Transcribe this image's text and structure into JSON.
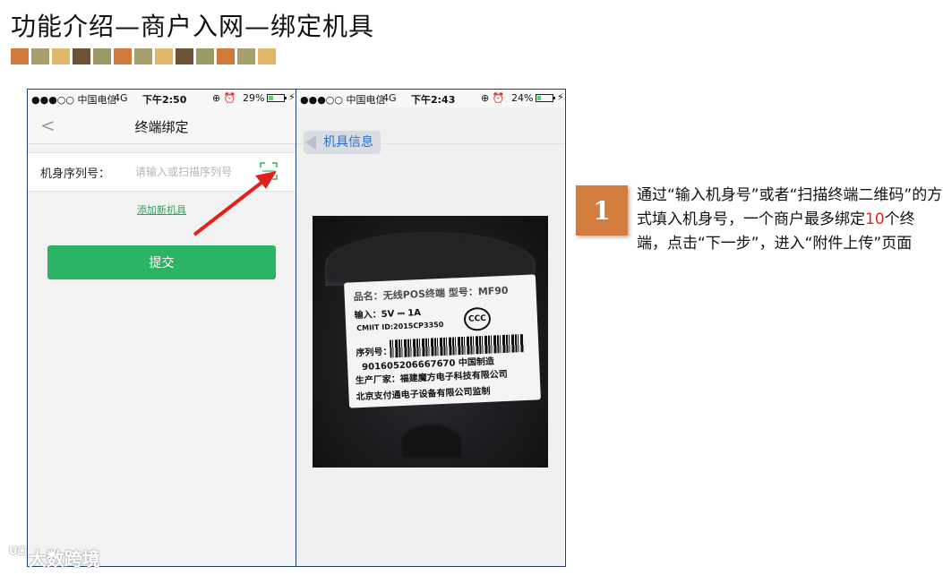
{
  "slide": {
    "title": "功能介绍—商户入网—绑定机具",
    "swatch_colors": [
      "#d07a3c",
      "#a79f6c",
      "#e2b769",
      "#6e5235",
      "#9b9a66",
      "#d07a3c",
      "#a79f6c",
      "#e2b769",
      "#6e5235",
      "#9b9a66",
      "#d07a3c",
      "#a79f6c",
      "#e2b769"
    ]
  },
  "phone_left": {
    "status": {
      "carrier": "●●●○○ 中国电信",
      "network": "4G",
      "time": "下午2:50",
      "icons": "⊕ ⏰",
      "battery_text": "29%",
      "battery_level": 0.29
    },
    "nav": {
      "back_icon": "chevron-left-icon",
      "title": "终端绑定"
    },
    "form": {
      "label": "机身序列号：",
      "placeholder": "请输入或扫描序列号",
      "value": ""
    },
    "add_link": "添加新机具",
    "submit": "提交"
  },
  "phone_right": {
    "status": {
      "carrier": "●●●○○ 中国电信",
      "network": "4G",
      "time": "下午2:43",
      "icons": "⊕ ⏰",
      "battery_text": "24%",
      "battery_level": 0.24
    },
    "nav": {
      "back_label": "机具信息"
    },
    "device_label": {
      "line1": "品名：无线POS终端 型号：MF90",
      "line2": "输入：5V ⎓ 1A",
      "line3": "CMIIT ID:2015CP3350",
      "line4": "序列号：",
      "serial": "901605206667670 中国制造",
      "line6": "生产厂家：福建魔方电子科技有限公司",
      "line7": "北京支付通电子设备有限公司监制",
      "cert": "CCC"
    }
  },
  "step": {
    "number": "1",
    "text_before": "通过“输入机身号”或者“扫描终端二维码”的方式填入机身号，一个商户最多绑定",
    "highlight": "10",
    "text_after": "个终端，点击“下一步”，进入“附件上传”页面"
  },
  "watermark": {
    "logo": "ᑌᗝ",
    "text": "大数跨境"
  },
  "colors": {
    "accent_green": "#2bb463",
    "badge": "#d27d3e",
    "highlight_red": "#e0241b",
    "link_blue": "#2f6fc2"
  }
}
